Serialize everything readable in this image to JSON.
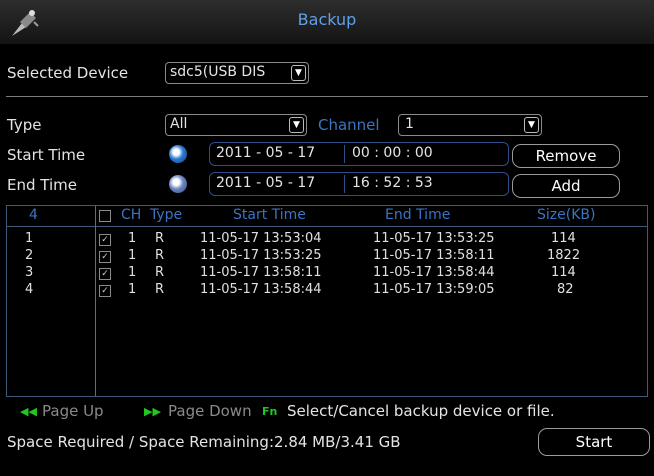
{
  "window": {
    "title": "Backup"
  },
  "device": {
    "label": "Selected Device",
    "value": "sdc5(USB DIS"
  },
  "filter": {
    "type_label": "Type",
    "type_value": "All",
    "channel_label": "Channel",
    "channel_value": "1",
    "start_label": "Start Time",
    "start_date": "2011 - 05 - 17",
    "start_time": "00 : 00 : 00",
    "end_label": "End Time",
    "end_date": "2011 - 05 - 17",
    "end_time": "16 : 52 : 53"
  },
  "buttons": {
    "remove": "Remove",
    "add": "Add",
    "start": "Start"
  },
  "table": {
    "headers": {
      "count": "4",
      "ch": "CH",
      "type": "Type",
      "start": "Start Time",
      "end": "End Time",
      "size": "Size(KB)"
    },
    "rows": [
      {
        "num": "1",
        "ch": "1",
        "type": "R",
        "start": "11-05-17 13:53:04",
        "end": "11-05-17 13:53:25",
        "size": "114",
        "checked": true
      },
      {
        "num": "2",
        "ch": "1",
        "type": "R",
        "start": "11-05-17 13:53:25",
        "end": "11-05-17 13:58:11",
        "size": "1822",
        "checked": true
      },
      {
        "num": "3",
        "ch": "1",
        "type": "R",
        "start": "11-05-17 13:58:11",
        "end": "11-05-17 13:58:44",
        "size": "114",
        "checked": true
      },
      {
        "num": "4",
        "ch": "1",
        "type": "R",
        "start": "11-05-17 13:58:44",
        "end": "11-05-17 13:59:05",
        "size": "82",
        "checked": true
      }
    ]
  },
  "hints": {
    "page_up": "Page Up",
    "page_down": "Page Down",
    "fn_key": "Fn",
    "select": "Select/Cancel backup device or file."
  },
  "status": {
    "text": "Space Required / Space Remaining:2.84 MB/3.41 GB"
  },
  "colors": {
    "accent": "#3a74c4",
    "title": "#5fa0e8",
    "hint_icon": "#22c722"
  }
}
